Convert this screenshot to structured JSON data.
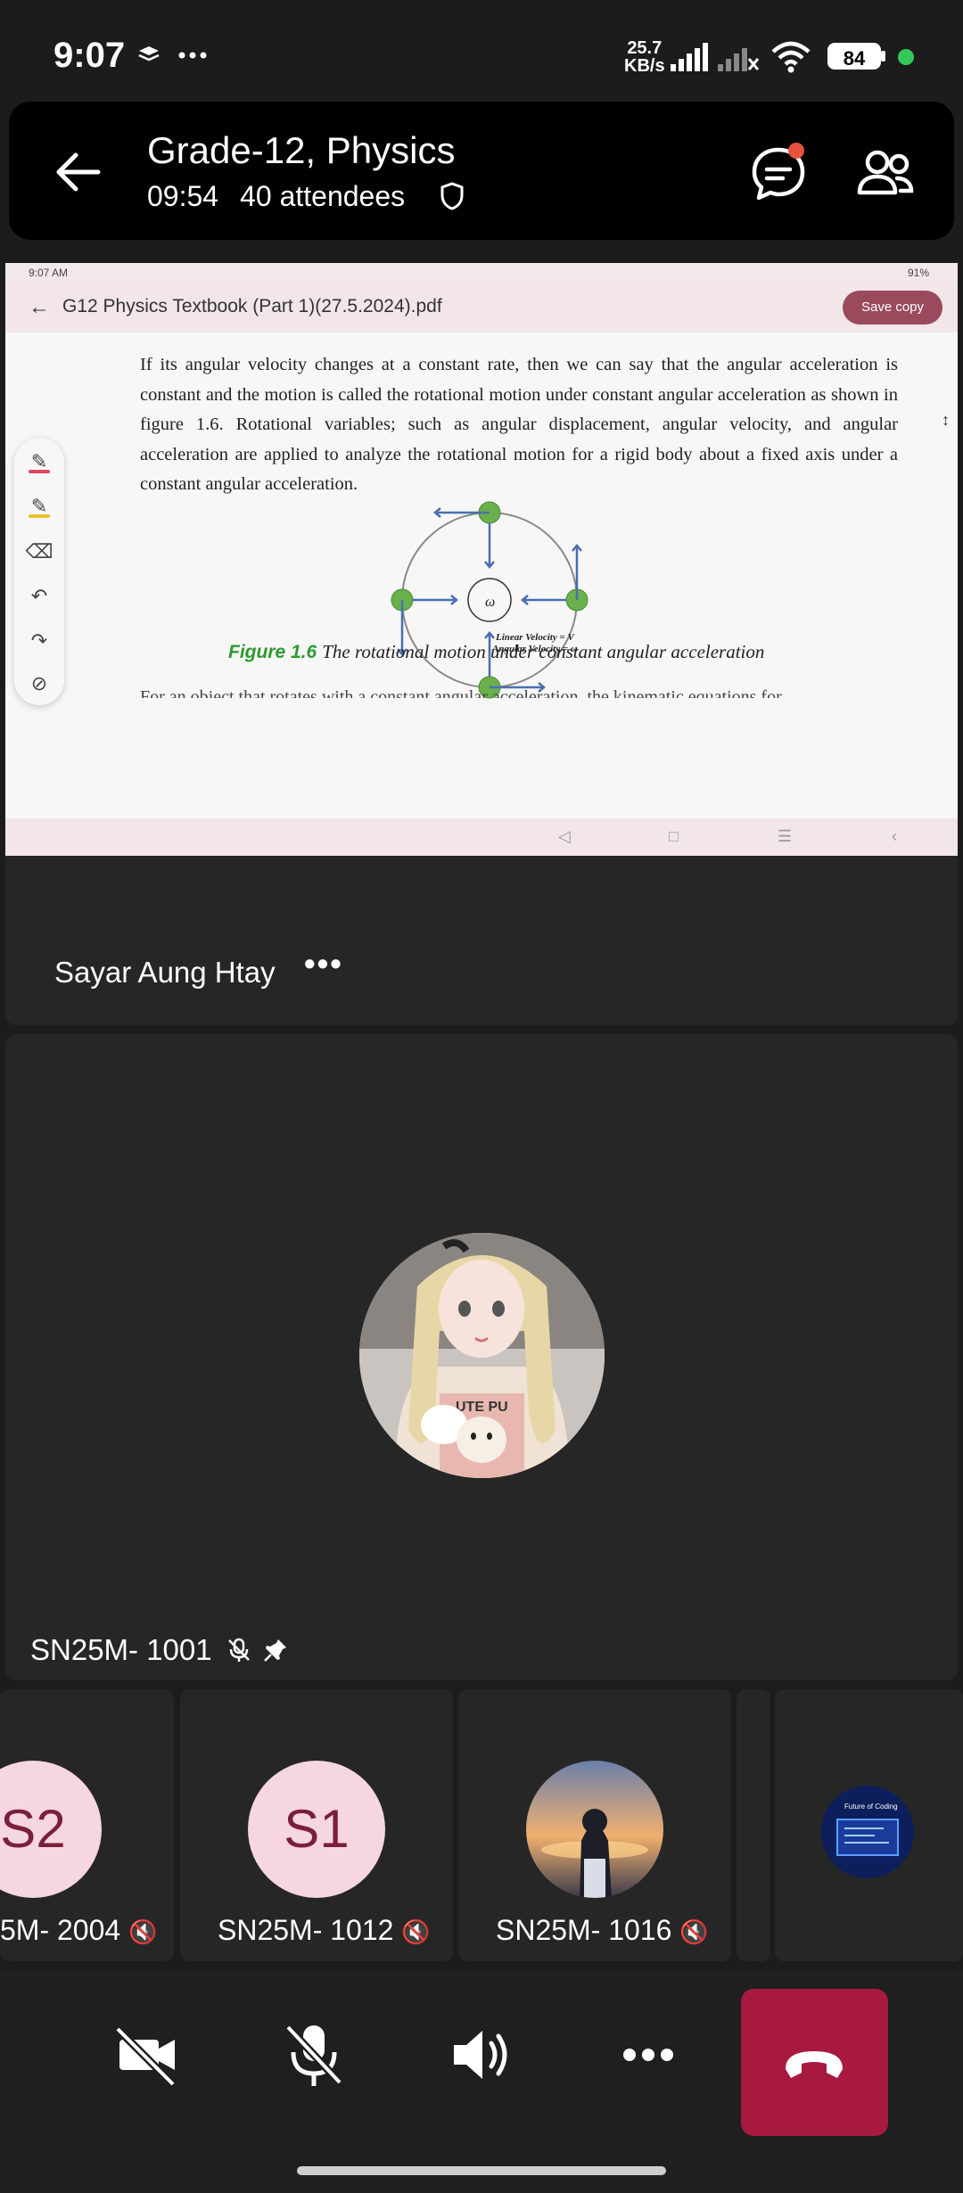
{
  "status_bar": {
    "time": "9:07",
    "icons": [
      "layers-icon",
      "more-dots-icon"
    ],
    "net_speed_value": "25.7",
    "net_speed_unit": "KB/s",
    "battery": "84",
    "status_color": "#34c759"
  },
  "header": {
    "title": "Grade-12, Physics",
    "duration": "09:54",
    "attendees": "40 attendees",
    "chat_badge_color": "#e5533d"
  },
  "shared_screen": {
    "status_time": "9:07 AM",
    "status_battery": "91%",
    "doc_title": "G12 Physics Textbook (Part 1)(27.5.2024).pdf",
    "save_copy_label": "Save copy",
    "paragraph": "If its angular velocity changes at a constant rate, then we can say that the angular acceleration is constant and the motion is called the rotational motion under constant angular acceleration as shown in figure 1.6. Rotational variables; such as angular displacement, angular velocity, and angular acceleration are applied to analyze the rotational motion for a rigid body about a fixed axis under a constant angular acceleration.",
    "diagram_omega": "ω",
    "diagram_legend_1": "Linear Velocity = V",
    "diagram_legend_2": "Angular Velocity = ω",
    "figure_label": "Figure 1.6",
    "figure_caption": "The rotational motion under constant angular acceleration",
    "cut_line": "For an object that rotates with a constant angular acceleration, the kinematic equations for",
    "toolbar_tools": [
      "pen-icon",
      "highlighter-icon",
      "eraser-icon",
      "undo-icon",
      "redo-icon",
      "hide-icon"
    ]
  },
  "presenter": {
    "name": "Sayar Aung Htay",
    "more": "•••"
  },
  "main_tile": {
    "name": "SN25M- 1001"
  },
  "thumbnails": [
    {
      "initials": "S2",
      "name": "5M- 2004"
    },
    {
      "initials": "S1",
      "name": "SN25M- 1012"
    },
    {
      "initials": "",
      "name": "SN25M- 1016"
    },
    {
      "initials": "",
      "name": ""
    }
  ],
  "controls": {
    "video": "camera-off-icon",
    "mic": "mic-off-icon",
    "speaker": "speaker-icon",
    "more": "more-icon",
    "hangup": "hang-up-icon",
    "hangup_color": "#a8193f"
  }
}
